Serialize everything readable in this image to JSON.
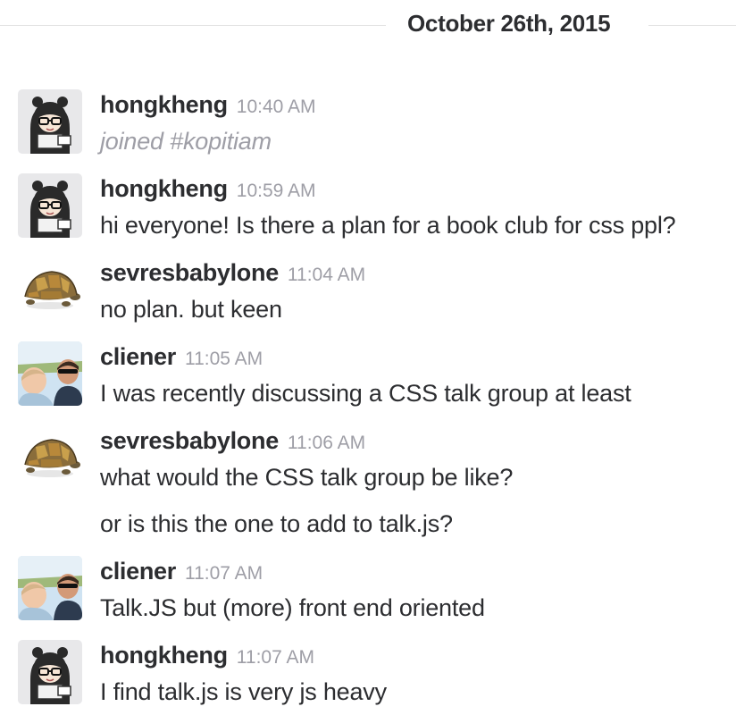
{
  "date_divider": "October 26th, 2015",
  "messages": [
    {
      "user": "hongkheng",
      "time": "10:40 AM",
      "avatar": "girl-with-glasses-avatar",
      "lines": [
        "joined #kopitiam"
      ],
      "system": true
    },
    {
      "user": "hongkheng",
      "time": "10:59 AM",
      "avatar": "girl-with-glasses-avatar",
      "lines": [
        "hi everyone! Is there a plan for a book club for css ppl?"
      ]
    },
    {
      "user": "sevresbabylone",
      "time": "11:04 AM",
      "avatar": "turtle-avatar",
      "lines": [
        "no plan. but keen"
      ]
    },
    {
      "user": "cliener",
      "time": "11:05 AM",
      "avatar": "man-with-child-photo-avatar",
      "lines": [
        "I was recently discussing a CSS talk group at least"
      ]
    },
    {
      "user": "sevresbabylone",
      "time": "11:06 AM",
      "avatar": "turtle-avatar",
      "lines": [
        "what would the CSS talk group be like?",
        "or is this the one to add to talk.js?"
      ]
    },
    {
      "user": "cliener",
      "time": "11:07 AM",
      "avatar": "man-with-child-photo-avatar",
      "lines": [
        "Talk.JS but (more) front end oriented"
      ]
    },
    {
      "user": "hongkheng",
      "time": "11:07 AM",
      "avatar": "girl-with-glasses-avatar",
      "lines": [
        "I find talk.js is very js heavy"
      ]
    }
  ],
  "colors": {
    "text": "#2c2d30",
    "muted": "#9e9ea6",
    "divider": "#e3e3e3",
    "avatar_bg": "#e8e8ea"
  }
}
